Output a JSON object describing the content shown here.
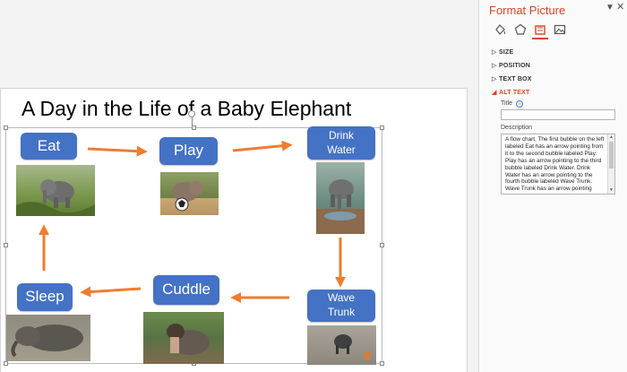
{
  "slide": {
    "title": "A Day in the Life of a Baby Elephant",
    "steps": [
      {
        "id": "eat",
        "label": "Eat"
      },
      {
        "id": "play",
        "label": "Play"
      },
      {
        "id": "drink",
        "label": "Drink Water"
      },
      {
        "id": "wave",
        "label": "Wave Trunk"
      },
      {
        "id": "cuddle",
        "label": "Cuddle"
      },
      {
        "id": "sleep",
        "label": "Sleep"
      }
    ],
    "accent_color": "#4472c4",
    "arrow_color": "#ed7d31"
  },
  "pane": {
    "title": "Format Picture",
    "dropdown_icon": "chevron-down-icon",
    "close_icon": "close-icon",
    "tabs": [
      {
        "name": "fill-line-icon"
      },
      {
        "name": "effects-icon"
      },
      {
        "name": "size-properties-icon"
      },
      {
        "name": "picture-icon"
      }
    ],
    "sections": [
      "SIZE",
      "POSITION",
      "TEXT BOX",
      "ALT TEXT"
    ],
    "alt_text": {
      "title_label": "Title",
      "title_value": "",
      "description_label": "Description",
      "description_value": "A flow chart. The first bubble on the left labeled Eat has an arrow pointing from it to the second bubble labeled Play. Play has an arrow pointing to the third bubble labeled Drink Water. Drink Water has an arrow pointing to the fourth bubble labeled Wave Trunk. Wave Trunk has an arrow pointing"
    },
    "accent_color": "#d24726"
  }
}
